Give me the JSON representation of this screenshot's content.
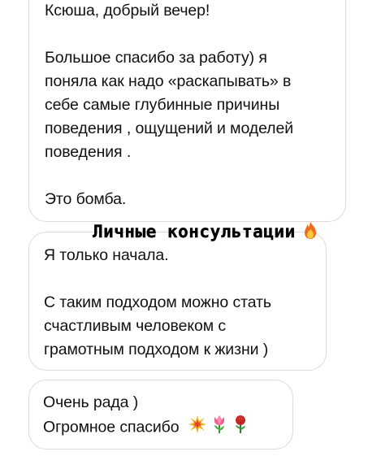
{
  "messages": [
    {
      "lines": [
        "Ксюша, добрый вечер!"
      ],
      "para2": [
        "Большое спасибо за работу) я",
        "поняла как надо «раскапывать» в",
        "себе самые глубинные причины",
        "поведения , ощущений и моделей",
        "поведения ."
      ],
      "para3": [
        "Это бомба."
      ]
    },
    {
      "para1": [
        "Я только начала."
      ],
      "para2": [
        "С таким подходом можно стать",
        "счастливым человеком с",
        "грамотным подходом к жизни )"
      ]
    },
    {
      "line1": "Очень рада )",
      "line2": "Огромное спасибо"
    }
  ],
  "sticker": {
    "text": "Личные консультации",
    "icon": "fire-icon"
  },
  "emojis": [
    "collision-icon",
    "tulip-icon",
    "rose-icon"
  ]
}
